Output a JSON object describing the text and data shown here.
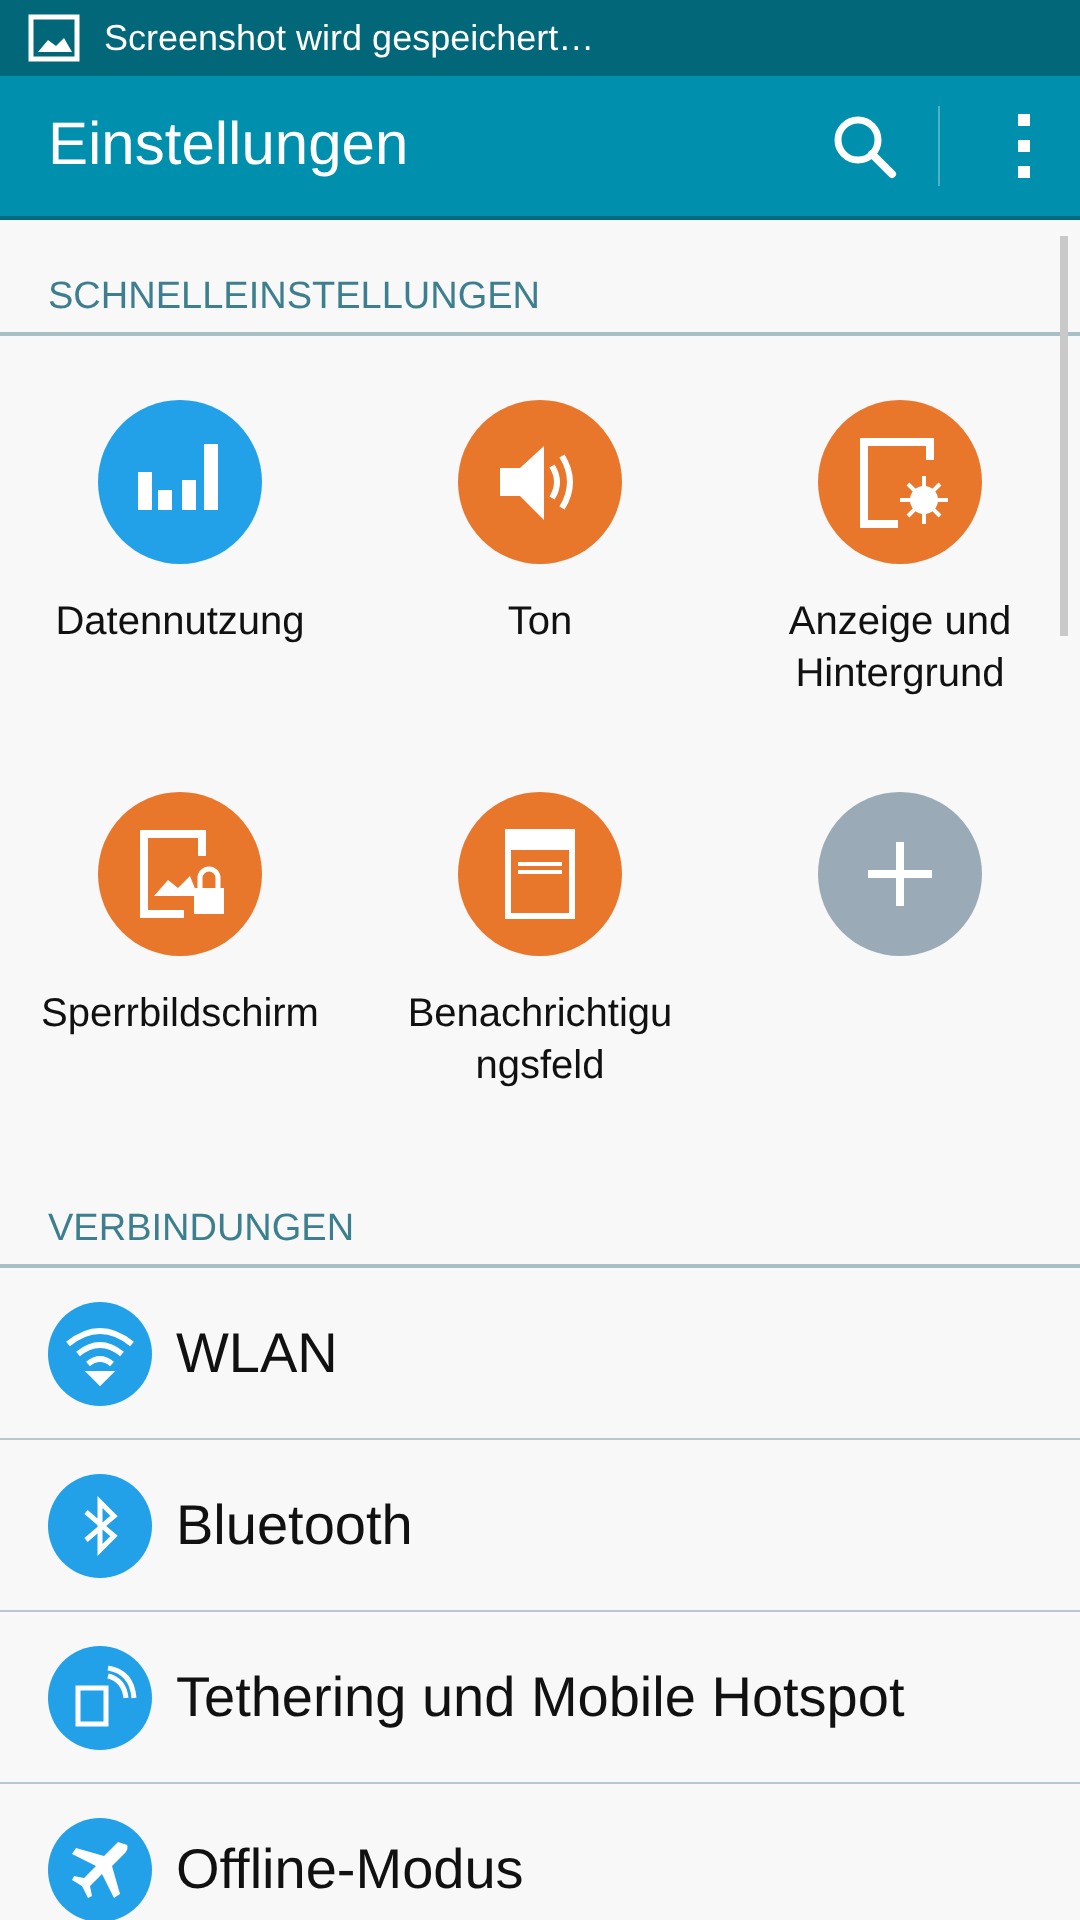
{
  "status_bar": {
    "notification": "Screenshot wird gespeichert…"
  },
  "toolbar": {
    "title": "Einstellungen"
  },
  "quick_settings": {
    "header": "SCHNELLEINSTELLUNGEN",
    "tiles": [
      {
        "label": "Datennutzung",
        "kind": "data",
        "color": "#22a0e8"
      },
      {
        "label": "Ton",
        "kind": "sound",
        "color": "#e8762b"
      },
      {
        "label": "Anzeige und Hintergrund",
        "kind": "display",
        "color": "#e8762b"
      },
      {
        "label": "Sperrbildschirm",
        "kind": "lock",
        "color": "#e8762b"
      },
      {
        "label": "Benachrichtigungsfeld",
        "kind": "panel",
        "color": "#e8762b"
      },
      {
        "kind": "add",
        "color": "#9aabb7"
      }
    ]
  },
  "connections": {
    "header": "VERBINDUNGEN",
    "items": [
      {
        "label": "WLAN",
        "kind": "wifi"
      },
      {
        "label": "Bluetooth",
        "kind": "bluetooth"
      },
      {
        "label": "Tethering und Mobile Hotspot",
        "kind": "hotspot"
      },
      {
        "label": "Offline-Modus",
        "kind": "airplane"
      }
    ]
  }
}
